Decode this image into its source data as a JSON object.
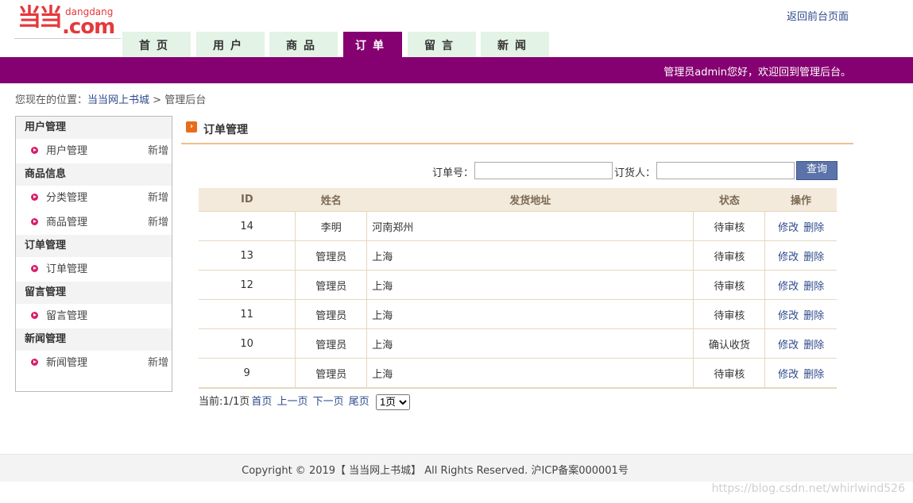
{
  "logo": {
    "mark": "当当",
    "small": "dangdang",
    "big": ".com"
  },
  "header": {
    "return_link": "返回前台页面"
  },
  "nav": {
    "tabs": [
      "首页",
      "用户",
      "商品",
      "订单",
      "留言",
      "新闻"
    ],
    "active": "订单"
  },
  "banner": {
    "welcome": "管理员admin您好，欢迎回到管理后台。"
  },
  "breadcrumb": {
    "prefix": "您现在的位置：",
    "home": "当当网上书城",
    "separator": " > ",
    "current": "管理后台"
  },
  "sidebar": {
    "groups": [
      {
        "title": "用户管理",
        "items": [
          {
            "label": "用户管理",
            "add": "新增"
          }
        ]
      },
      {
        "title": "商品信息",
        "items": [
          {
            "label": "分类管理",
            "add": "新增"
          },
          {
            "label": "商品管理",
            "add": "新增"
          }
        ]
      },
      {
        "title": "订单管理",
        "items": [
          {
            "label": "订单管理",
            "add": ""
          }
        ]
      },
      {
        "title": "留言管理",
        "items": [
          {
            "label": "留言管理",
            "add": ""
          }
        ]
      },
      {
        "title": "新闻管理",
        "items": [
          {
            "label": "新闻管理",
            "add": "新增"
          }
        ]
      }
    ]
  },
  "main": {
    "title": "订单管理",
    "search": {
      "order_no_label": "订单号：",
      "order_no_value": "",
      "buyer_label": "订货人：",
      "buyer_value": "",
      "query_button": "查询"
    },
    "table": {
      "headers": [
        "ID",
        "姓名",
        "发货地址",
        "状态",
        "操作"
      ],
      "rows": [
        {
          "id": "14",
          "name": "李明",
          "address": "河南郑州",
          "status": "待审核"
        },
        {
          "id": "13",
          "name": "管理员",
          "address": "上海",
          "status": "待审核"
        },
        {
          "id": "12",
          "name": "管理员",
          "address": "上海",
          "status": "待审核"
        },
        {
          "id": "11",
          "name": "管理员",
          "address": "上海",
          "status": "待审核"
        },
        {
          "id": "10",
          "name": "管理员",
          "address": "上海",
          "status": "确认收货"
        },
        {
          "id": "9",
          "name": "管理员",
          "address": "上海",
          "status": "待审核"
        }
      ],
      "edit_label": "修改",
      "delete_label": "删除"
    },
    "pager": {
      "current": "当前:1/1页",
      "first": "首页",
      "prev": "上一页",
      "next": "下一页",
      "last": "尾页",
      "options": [
        "1页"
      ],
      "selected": "1页"
    }
  },
  "footer": {
    "copyright": "Copyright © 2019【 当当网上书城】 All Rights Reserved. 沪ICP备案000001号"
  },
  "watermark": "https://blog.csdn.net/whirlwind526",
  "colors": {
    "brand": "#850070",
    "logo": "#e4393c",
    "nav_tab_bg": "#e3f3e5",
    "link": "#2e4b8c",
    "table_header_bg": "#f4eadb",
    "title_underline": "#f0c08c"
  }
}
